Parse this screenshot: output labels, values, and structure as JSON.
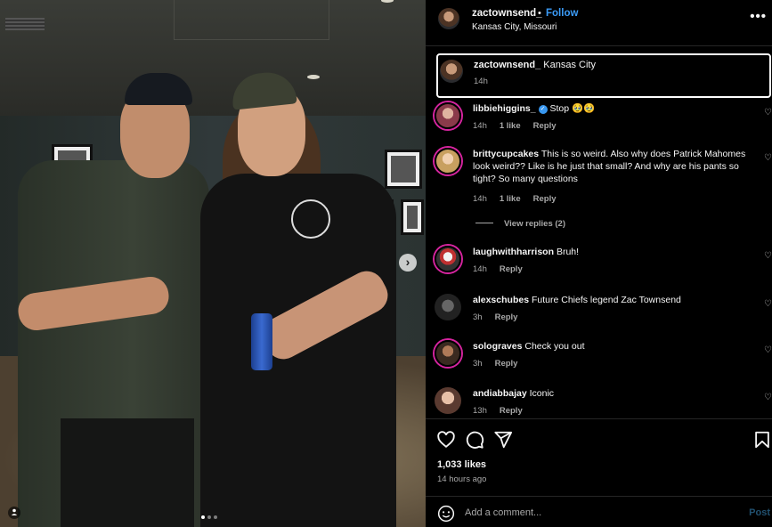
{
  "post": {
    "author": "zactownsend_",
    "separator": "•",
    "follow_label": "Follow",
    "location": "Kansas City, Missouri",
    "more_label": "•••",
    "caption": {
      "author": "zactownsend_",
      "text": "Kansas City",
      "time": "14h"
    },
    "carousel": {
      "next_glyph": "›",
      "slide_count": 3,
      "active_slide": 1
    }
  },
  "comments": [
    {
      "user": "libbiehiggins_",
      "verified": true,
      "text": "Stop 🥹🥹",
      "time": "14h",
      "likes": "1 like",
      "reply": "Reply"
    },
    {
      "user": "brittycupcakes",
      "verified": false,
      "text": "This is so weird. Also why does Patrick Mahomes look weird?? Like is he just that small? And why are his pants so tight? So many questions",
      "time": "14h",
      "likes": "1 like",
      "reply": "Reply",
      "view_replies": "View replies (2)"
    },
    {
      "user": "laughwithharrison",
      "verified": false,
      "text": "Bruh!",
      "time": "14h",
      "reply": "Reply"
    },
    {
      "user": "alexschubes",
      "verified": false,
      "text": "Future Chiefs legend Zac Townsend",
      "time": "3h",
      "reply": "Reply"
    },
    {
      "user": "solograves",
      "verified": false,
      "text": "Check you out",
      "time": "3h",
      "reply": "Reply"
    },
    {
      "user": "andiabbajay",
      "verified": false,
      "text": "Iconic",
      "time": "13h",
      "reply": "Reply"
    }
  ],
  "stats": {
    "likes": "1,033 likes",
    "time_ago": "14 hours ago"
  },
  "composer": {
    "placeholder": "Add a comment...",
    "post_label": "Post"
  },
  "icons": [
    "heart-icon",
    "comment-icon",
    "share-icon",
    "bookmark-icon",
    "emoji-icon",
    "more-icon",
    "chevron-right-icon",
    "user-tag-icon"
  ],
  "colors": {
    "background": "#000000",
    "link": "#3b9bf6",
    "muted": "#a8a8a8",
    "post_disabled": "#21506f"
  }
}
